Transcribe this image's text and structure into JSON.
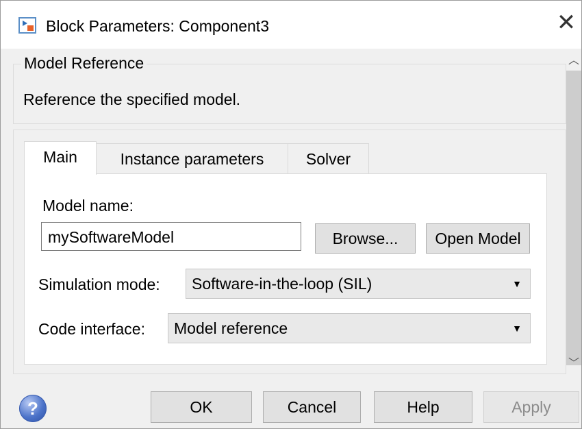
{
  "window": {
    "title": "Block Parameters: Component3"
  },
  "icons": {
    "app": "simulink-block-icon",
    "close": "close-icon",
    "help": "help-icon",
    "dropdown": "chevron-down-icon"
  },
  "header": {
    "section_label": "Model Reference",
    "description": "Reference the specified model."
  },
  "tabs": [
    {
      "label": "Main",
      "active": true
    },
    {
      "label": "Instance parameters",
      "active": false
    },
    {
      "label": "Solver",
      "active": false
    }
  ],
  "main": {
    "model_name_label": "Model name:",
    "model_name_value": "mySoftwareModel",
    "browse_label": "Browse...",
    "open_model_label": "Open Model",
    "simulation_mode_label": "Simulation mode:",
    "simulation_mode_value": "Software-in-the-loop (SIL)",
    "code_interface_label": "Code interface:",
    "code_interface_value": "Model reference"
  },
  "footer": {
    "ok_label": "OK",
    "cancel_label": "Cancel",
    "help_label": "Help",
    "apply_label": "Apply",
    "apply_enabled": false
  }
}
